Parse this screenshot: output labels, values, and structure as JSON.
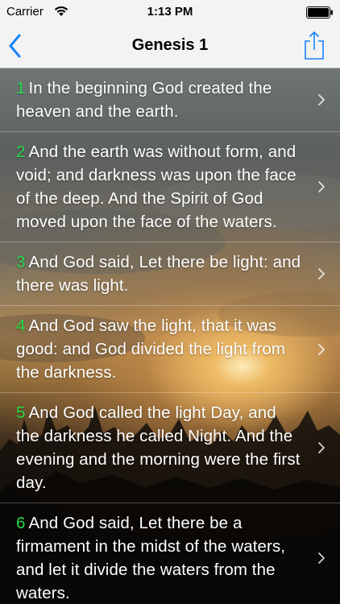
{
  "status_bar": {
    "carrier": "Carrier",
    "time": "1:13 PM"
  },
  "nav": {
    "title": "Genesis 1",
    "back_icon": "chevron-left-icon",
    "share_icon": "share-icon",
    "accent_color": "#1a82fb"
  },
  "verses": [
    {
      "num": "1",
      "text": "In the beginning God created the heaven and the earth."
    },
    {
      "num": "2",
      "text": "And the earth was without form, and void; and darkness was upon the face of the deep. And the Spirit of God moved upon the face of the waters."
    },
    {
      "num": "3",
      "text": "And God said, Let there be light: and there was light."
    },
    {
      "num": "4",
      "text": "And God saw the light, that it was good: and God divided the light from the darkness."
    },
    {
      "num": "5",
      "text": "And God called the light Day, and the darkness he called Night. And the evening and the morning were the first day."
    },
    {
      "num": "6",
      "text": "And God said, Let there be a firmament in the midst of the waters, and let it divide the waters from the waters."
    }
  ],
  "colors": {
    "verse_number": "#2bd94a",
    "verse_text": "#ffffff"
  }
}
